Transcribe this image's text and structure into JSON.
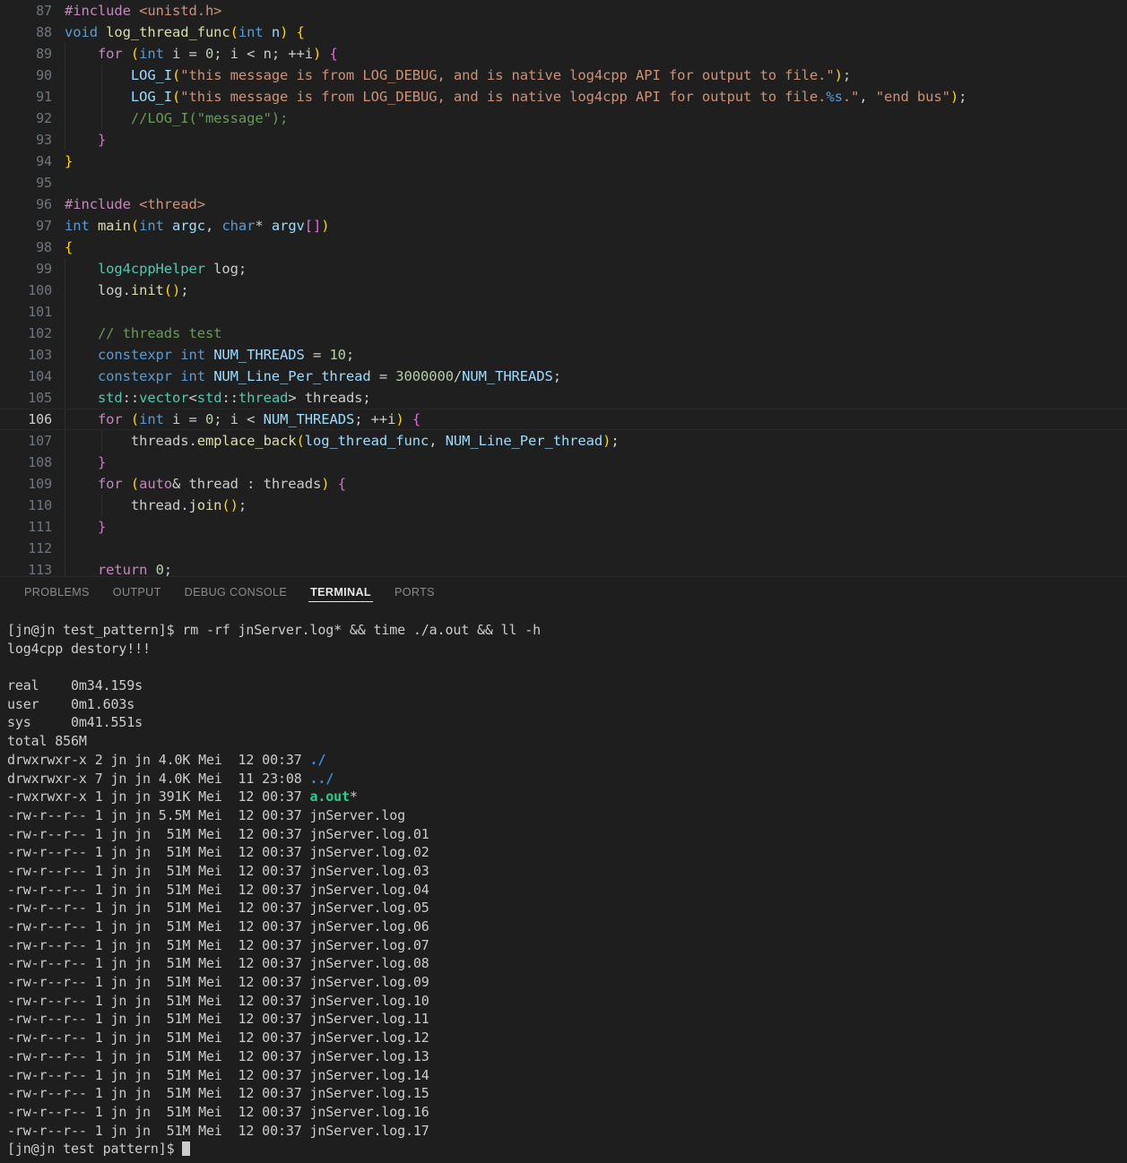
{
  "editor": {
    "background": "#1f1f1f",
    "active_line": 106,
    "lines": [
      {
        "num": "87",
        "indent": 0,
        "tokens": [
          {
            "t": "#include ",
            "c": "c-pre"
          },
          {
            "t": "<unistd.h>",
            "c": "c-str"
          }
        ]
      },
      {
        "num": "88",
        "indent": 0,
        "tokens": [
          {
            "t": "void ",
            "c": "c-kw"
          },
          {
            "t": "log_thread_func",
            "c": "c-fn"
          },
          {
            "t": "(",
            "c": "c-par1"
          },
          {
            "t": "int",
            "c": "c-kw"
          },
          {
            "t": " n",
            "c": "c-var"
          },
          {
            "t": ")",
            "c": "c-par1"
          },
          {
            "t": " ",
            "c": "c-punct"
          },
          {
            "t": "{",
            "c": "c-par1"
          }
        ]
      },
      {
        "num": "89",
        "indent": 1,
        "tokens": [
          {
            "t": "    ",
            "c": "c-punct"
          },
          {
            "t": "for ",
            "c": "c-ctrl"
          },
          {
            "t": "(",
            "c": "c-par1"
          },
          {
            "t": "int",
            "c": "c-kw"
          },
          {
            "t": " i = ",
            "c": "c-punct"
          },
          {
            "t": "0",
            "c": "c-num"
          },
          {
            "t": "; i < n; ++i",
            "c": "c-punct"
          },
          {
            "t": ")",
            "c": "c-par1"
          },
          {
            "t": " ",
            "c": "c-punct"
          },
          {
            "t": "{",
            "c": "c-par2"
          }
        ]
      },
      {
        "num": "90",
        "indent": 2,
        "tokens": [
          {
            "t": "        ",
            "c": "c-punct"
          },
          {
            "t": "LOG_I",
            "c": "c-var"
          },
          {
            "t": "(",
            "c": "c-par1"
          },
          {
            "t": "\"this message is from LOG_DEBUG, and is native log4cpp API for output to file.\"",
            "c": "c-str"
          },
          {
            "t": ")",
            "c": "c-par1"
          },
          {
            "t": ";",
            "c": "c-punct"
          }
        ]
      },
      {
        "num": "91",
        "indent": 2,
        "tokens": [
          {
            "t": "        ",
            "c": "c-punct"
          },
          {
            "t": "LOG_I",
            "c": "c-var"
          },
          {
            "t": "(",
            "c": "c-par1"
          },
          {
            "t": "\"this message is from LOG_DEBUG, and is native log4cpp API for output to file.",
            "c": "c-str"
          },
          {
            "t": "%s",
            "c": "c-fmt"
          },
          {
            "t": ".\"",
            "c": "c-str"
          },
          {
            "t": ", ",
            "c": "c-punct"
          },
          {
            "t": "\"end bus\"",
            "c": "c-str"
          },
          {
            "t": ")",
            "c": "c-par1"
          },
          {
            "t": ";",
            "c": "c-punct"
          }
        ]
      },
      {
        "num": "92",
        "indent": 2,
        "tokens": [
          {
            "t": "        ",
            "c": "c-punct"
          },
          {
            "t": "//LOG_I(\"message\");",
            "c": "c-cmt"
          }
        ]
      },
      {
        "num": "93",
        "indent": 1,
        "tokens": [
          {
            "t": "    ",
            "c": "c-punct"
          },
          {
            "t": "}",
            "c": "c-par2"
          }
        ]
      },
      {
        "num": "94",
        "indent": 0,
        "tokens": [
          {
            "t": "}",
            "c": "c-par1"
          }
        ]
      },
      {
        "num": "95",
        "indent": 0,
        "tokens": []
      },
      {
        "num": "96",
        "indent": 0,
        "tokens": [
          {
            "t": "#include ",
            "c": "c-pre"
          },
          {
            "t": "<thread>",
            "c": "c-str"
          }
        ]
      },
      {
        "num": "97",
        "indent": 0,
        "tokens": [
          {
            "t": "int ",
            "c": "c-kw"
          },
          {
            "t": "main",
            "c": "c-fn"
          },
          {
            "t": "(",
            "c": "c-par1"
          },
          {
            "t": "int",
            "c": "c-kw"
          },
          {
            "t": " argc",
            "c": "c-var"
          },
          {
            "t": ", ",
            "c": "c-punct"
          },
          {
            "t": "char",
            "c": "c-kw"
          },
          {
            "t": "* ",
            "c": "c-punct"
          },
          {
            "t": "argv",
            "c": "c-var"
          },
          {
            "t": "[]",
            "c": "c-par2"
          },
          {
            "t": ")",
            "c": "c-par1"
          }
        ]
      },
      {
        "num": "98",
        "indent": 0,
        "tokens": [
          {
            "t": "{",
            "c": "c-par1"
          }
        ]
      },
      {
        "num": "99",
        "indent": 1,
        "tokens": [
          {
            "t": "    ",
            "c": "c-punct"
          },
          {
            "t": "log4cppHelper",
            "c": "c-type"
          },
          {
            "t": " log;",
            "c": "c-punct"
          }
        ]
      },
      {
        "num": "100",
        "indent": 1,
        "tokens": [
          {
            "t": "    log.",
            "c": "c-punct"
          },
          {
            "t": "init",
            "c": "c-fn"
          },
          {
            "t": "()",
            "c": "c-par1"
          },
          {
            "t": ";",
            "c": "c-punct"
          }
        ]
      },
      {
        "num": "101",
        "indent": 1,
        "tokens": []
      },
      {
        "num": "102",
        "indent": 1,
        "tokens": [
          {
            "t": "    ",
            "c": "c-punct"
          },
          {
            "t": "// threads test",
            "c": "c-cmt"
          }
        ]
      },
      {
        "num": "103",
        "indent": 1,
        "tokens": [
          {
            "t": "    ",
            "c": "c-punct"
          },
          {
            "t": "constexpr int",
            "c": "c-kw"
          },
          {
            "t": " ",
            "c": "c-punct"
          },
          {
            "t": "NUM_THREADS",
            "c": "c-const"
          },
          {
            "t": " = ",
            "c": "c-punct"
          },
          {
            "t": "10",
            "c": "c-num"
          },
          {
            "t": ";",
            "c": "c-punct"
          }
        ]
      },
      {
        "num": "104",
        "indent": 1,
        "tokens": [
          {
            "t": "    ",
            "c": "c-punct"
          },
          {
            "t": "constexpr int",
            "c": "c-kw"
          },
          {
            "t": " ",
            "c": "c-punct"
          },
          {
            "t": "NUM_Line_Per_thread",
            "c": "c-const"
          },
          {
            "t": " = ",
            "c": "c-punct"
          },
          {
            "t": "3000000",
            "c": "c-num"
          },
          {
            "t": "/",
            "c": "c-punct"
          },
          {
            "t": "NUM_THREADS",
            "c": "c-const"
          },
          {
            "t": ";",
            "c": "c-punct"
          }
        ]
      },
      {
        "num": "105",
        "indent": 1,
        "tokens": [
          {
            "t": "    ",
            "c": "c-punct"
          },
          {
            "t": "std",
            "c": "c-type"
          },
          {
            "t": "::",
            "c": "c-punct"
          },
          {
            "t": "vector",
            "c": "c-type"
          },
          {
            "t": "<",
            "c": "c-punct"
          },
          {
            "t": "std",
            "c": "c-type"
          },
          {
            "t": "::",
            "c": "c-punct"
          },
          {
            "t": "thread",
            "c": "c-type"
          },
          {
            "t": "> threads;",
            "c": "c-punct"
          }
        ]
      },
      {
        "num": "106",
        "indent": 1,
        "tokens": [
          {
            "t": "    ",
            "c": "c-punct"
          },
          {
            "t": "for ",
            "c": "c-ctrl"
          },
          {
            "t": "(",
            "c": "c-par1"
          },
          {
            "t": "int",
            "c": "c-kw"
          },
          {
            "t": " i = ",
            "c": "c-punct"
          },
          {
            "t": "0",
            "c": "c-num"
          },
          {
            "t": "; i < ",
            "c": "c-punct"
          },
          {
            "t": "NUM_THREADS",
            "c": "c-const"
          },
          {
            "t": "; ++i",
            "c": "c-punct"
          },
          {
            "t": ")",
            "c": "c-par1"
          },
          {
            "t": " ",
            "c": "c-punct"
          },
          {
            "t": "{",
            "c": "c-par2"
          }
        ]
      },
      {
        "num": "107",
        "indent": 2,
        "tokens": [
          {
            "t": "        threads.",
            "c": "c-punct"
          },
          {
            "t": "emplace_back",
            "c": "c-fn"
          },
          {
            "t": "(",
            "c": "c-par1"
          },
          {
            "t": "log_thread_func",
            "c": "c-var"
          },
          {
            "t": ", ",
            "c": "c-punct"
          },
          {
            "t": "NUM_Line_Per_thread",
            "c": "c-const"
          },
          {
            "t": ")",
            "c": "c-par1"
          },
          {
            "t": ";",
            "c": "c-punct"
          }
        ]
      },
      {
        "num": "108",
        "indent": 1,
        "tokens": [
          {
            "t": "    ",
            "c": "c-punct"
          },
          {
            "t": "}",
            "c": "c-par2"
          }
        ]
      },
      {
        "num": "109",
        "indent": 1,
        "tokens": [
          {
            "t": "    ",
            "c": "c-punct"
          },
          {
            "t": "for ",
            "c": "c-ctrl"
          },
          {
            "t": "(",
            "c": "c-par1"
          },
          {
            "t": "auto",
            "c": "c-ctrl"
          },
          {
            "t": "& thread : threads",
            "c": "c-punct"
          },
          {
            "t": ")",
            "c": "c-par1"
          },
          {
            "t": " ",
            "c": "c-punct"
          },
          {
            "t": "{",
            "c": "c-par2"
          }
        ]
      },
      {
        "num": "110",
        "indent": 2,
        "tokens": [
          {
            "t": "        thread.",
            "c": "c-punct"
          },
          {
            "t": "join",
            "c": "c-fn"
          },
          {
            "t": "()",
            "c": "c-par1"
          },
          {
            "t": ";",
            "c": "c-punct"
          }
        ]
      },
      {
        "num": "111",
        "indent": 1,
        "tokens": [
          {
            "t": "    ",
            "c": "c-punct"
          },
          {
            "t": "}",
            "c": "c-par2"
          }
        ]
      },
      {
        "num": "112",
        "indent": 1,
        "tokens": []
      },
      {
        "num": "113",
        "indent": 1,
        "tokens": [
          {
            "t": "    ",
            "c": "c-punct"
          },
          {
            "t": "return ",
            "c": "c-ctrl"
          },
          {
            "t": "0",
            "c": "c-num"
          },
          {
            "t": ";",
            "c": "c-punct"
          }
        ]
      }
    ]
  },
  "panel": {
    "tabs": [
      {
        "label": "PROBLEMS",
        "active": false
      },
      {
        "label": "OUTPUT",
        "active": false
      },
      {
        "label": "DEBUG CONSOLE",
        "active": false
      },
      {
        "label": "TERMINAL",
        "active": true
      },
      {
        "label": "PORTS",
        "active": false
      }
    ]
  },
  "terminal": {
    "prompt": "[jn@jn test_pattern]$ ",
    "command": "rm -rf jnServer.log* && time ./a.out && ll -h",
    "final_prompt": "[jn@jn test pattern]$ ",
    "lines": [
      {
        "segs": [
          {
            "t": "[jn@jn test_pattern]$ rm -rf jnServer.log* && time ./a.out && ll -h",
            "c": "t-def"
          }
        ]
      },
      {
        "segs": [
          {
            "t": "log4cpp destory!!!",
            "c": "t-def"
          }
        ]
      },
      {
        "segs": []
      },
      {
        "segs": [
          {
            "t": "real    0m34.159s",
            "c": "t-def"
          }
        ]
      },
      {
        "segs": [
          {
            "t": "user    0m1.603s",
            "c": "t-def"
          }
        ]
      },
      {
        "segs": [
          {
            "t": "sys     0m41.551s",
            "c": "t-def"
          }
        ]
      },
      {
        "segs": [
          {
            "t": "total 856M",
            "c": "t-def"
          }
        ]
      },
      {
        "segs": [
          {
            "t": "drwxrwxr-x 2 jn jn 4.0K Mei  12 00:37 ",
            "c": "t-def"
          },
          {
            "t": "./",
            "c": "t-dir"
          }
        ]
      },
      {
        "segs": [
          {
            "t": "drwxrwxr-x 7 jn jn 4.0K Mei  11 23:08 ",
            "c": "t-def"
          },
          {
            "t": "../",
            "c": "t-dir"
          }
        ]
      },
      {
        "segs": [
          {
            "t": "-rwxrwxr-x 1 jn jn 391K Mei  12 00:37 ",
            "c": "t-def"
          },
          {
            "t": "a.out",
            "c": "t-exe"
          },
          {
            "t": "*",
            "c": "t-def"
          }
        ]
      },
      {
        "segs": [
          {
            "t": "-rw-r--r-- 1 jn jn 5.5M Mei  12 00:37 jnServer.log",
            "c": "t-def"
          }
        ]
      },
      {
        "segs": [
          {
            "t": "-rw-r--r-- 1 jn jn  51M Mei  12 00:37 jnServer.log.01",
            "c": "t-def"
          }
        ]
      },
      {
        "segs": [
          {
            "t": "-rw-r--r-- 1 jn jn  51M Mei  12 00:37 jnServer.log.02",
            "c": "t-def"
          }
        ]
      },
      {
        "segs": [
          {
            "t": "-rw-r--r-- 1 jn jn  51M Mei  12 00:37 jnServer.log.03",
            "c": "t-def"
          }
        ]
      },
      {
        "segs": [
          {
            "t": "-rw-r--r-- 1 jn jn  51M Mei  12 00:37 jnServer.log.04",
            "c": "t-def"
          }
        ]
      },
      {
        "segs": [
          {
            "t": "-rw-r--r-- 1 jn jn  51M Mei  12 00:37 jnServer.log.05",
            "c": "t-def"
          }
        ]
      },
      {
        "segs": [
          {
            "t": "-rw-r--r-- 1 jn jn  51M Mei  12 00:37 jnServer.log.06",
            "c": "t-def"
          }
        ]
      },
      {
        "segs": [
          {
            "t": "-rw-r--r-- 1 jn jn  51M Mei  12 00:37 jnServer.log.07",
            "c": "t-def"
          }
        ]
      },
      {
        "segs": [
          {
            "t": "-rw-r--r-- 1 jn jn  51M Mei  12 00:37 jnServer.log.08",
            "c": "t-def"
          }
        ]
      },
      {
        "segs": [
          {
            "t": "-rw-r--r-- 1 jn jn  51M Mei  12 00:37 jnServer.log.09",
            "c": "t-def"
          }
        ]
      },
      {
        "segs": [
          {
            "t": "-rw-r--r-- 1 jn jn  51M Mei  12 00:37 jnServer.log.10",
            "c": "t-def"
          }
        ]
      },
      {
        "segs": [
          {
            "t": "-rw-r--r-- 1 jn jn  51M Mei  12 00:37 jnServer.log.11",
            "c": "t-def"
          }
        ]
      },
      {
        "segs": [
          {
            "t": "-rw-r--r-- 1 jn jn  51M Mei  12 00:37 jnServer.log.12",
            "c": "t-def"
          }
        ]
      },
      {
        "segs": [
          {
            "t": "-rw-r--r-- 1 jn jn  51M Mei  12 00:37 jnServer.log.13",
            "c": "t-def"
          }
        ]
      },
      {
        "segs": [
          {
            "t": "-rw-r--r-- 1 jn jn  51M Mei  12 00:37 jnServer.log.14",
            "c": "t-def"
          }
        ]
      },
      {
        "segs": [
          {
            "t": "-rw-r--r-- 1 jn jn  51M Mei  12 00:37 jnServer.log.15",
            "c": "t-def"
          }
        ]
      },
      {
        "segs": [
          {
            "t": "-rw-r--r-- 1 jn jn  51M Mei  12 00:37 jnServer.log.16",
            "c": "t-def"
          }
        ]
      },
      {
        "segs": [
          {
            "t": "-rw-r--r-- 1 jn jn  51M Mei  12 00:37 jnServer.log.17",
            "c": "t-def"
          }
        ]
      }
    ]
  }
}
